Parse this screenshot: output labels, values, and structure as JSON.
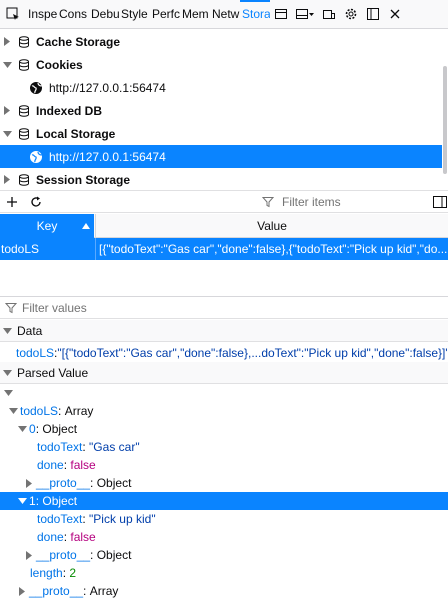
{
  "toolbar": {
    "tabs": [
      {
        "label": "Inspe",
        "icon": "inspector-icon"
      },
      {
        "label": "Cons",
        "icon": "console-icon"
      },
      {
        "label": "Debu",
        "icon": "debugger-icon"
      },
      {
        "label": "Style",
        "icon": "style-editor-icon"
      },
      {
        "label": "Perfc",
        "icon": "performance-icon"
      },
      {
        "label": "Mem",
        "icon": "memory-icon"
      },
      {
        "label": "Netw",
        "icon": "network-icon"
      },
      {
        "label": "Stora",
        "icon": "storage-icon",
        "selected": true
      }
    ],
    "accent": "#0a84ff"
  },
  "tree": {
    "items": [
      {
        "label": "Cache Storage",
        "kind": "db"
      },
      {
        "label": "Cookies",
        "kind": "db",
        "expanded": true
      },
      {
        "label": "http://127.0.0.1:56474",
        "kind": "host"
      },
      {
        "label": "Indexed DB",
        "kind": "db"
      },
      {
        "label": "Local Storage",
        "kind": "db",
        "expanded": true
      },
      {
        "label": "http://127.0.0.1:56474",
        "kind": "host",
        "selected": true
      },
      {
        "label": "Session Storage",
        "kind": "db"
      }
    ]
  },
  "table_toolbar": {
    "filter_placeholder": "Filter items"
  },
  "table": {
    "columns": [
      "Key",
      "Value"
    ],
    "rows": [
      {
        "key": "todoLS",
        "value": "[{\"todoText\":\"Gas car\",\"done\":false},{\"todoText\":\"Pick up kid\",\"do..."
      }
    ]
  },
  "sidebar": {
    "filter_placeholder": "Filter values",
    "data_section": "Data",
    "data_key": "todoLS",
    "data_sep": ": ",
    "data_value": "\"[{\"todoText\":\"Gas car\",\"done\":false},...doText\":\"Pick up kid\",\"done\":false}]\"",
    "parsed_section": "Parsed Value",
    "parsed": {
      "root_key": "todoLS",
      "root_type": "Array",
      "item0_key": "0",
      "item0_type": "Object",
      "item0_text_key": "todoText",
      "item0_text_val": "\"Gas car\"",
      "item0_done_key": "done",
      "item0_done_val": "false",
      "proto_key": "__proto__",
      "proto_obj": "Object",
      "item1_key": "1",
      "item1_type": "Object",
      "item1_text_key": "todoText",
      "item1_text_val": "\"Pick up kid\"",
      "item1_done_key": "done",
      "item1_done_val": "false",
      "length_key": "length",
      "length_val": "2",
      "proto_arr": "Array"
    }
  }
}
